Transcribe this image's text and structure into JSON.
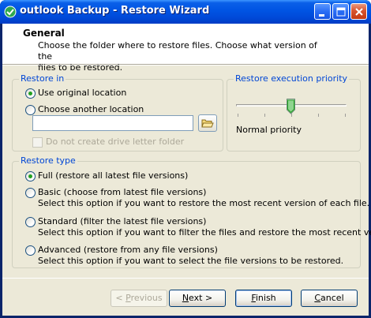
{
  "window": {
    "title": "outlook Backup - Restore Wizard",
    "title_bar_color": "#0054e3"
  },
  "header": {
    "title": "General",
    "description_line1": "Choose the folder where to restore files. Choose what version of the",
    "description_line2": "files to be restored."
  },
  "restore_in": {
    "label": "Restore in",
    "options": [
      {
        "label": "Use original location",
        "checked": true
      },
      {
        "label": "Choose another location",
        "checked": false
      }
    ],
    "location_value": "",
    "checkbox_label": "Do not create drive letter folder",
    "checkbox_checked": false
  },
  "priority": {
    "label": "Restore execution priority",
    "value_label": "Normal priority",
    "level": 0.5
  },
  "restore_type": {
    "label": "Restore type",
    "options": [
      {
        "label": "Full (restore all latest file versions)",
        "checked": true,
        "description": ""
      },
      {
        "label": "Basic (choose from latest file versions)",
        "checked": false,
        "description": "Select this option if you want to restore the most recent version of each file."
      },
      {
        "label": "Standard (filter the latest file versions)",
        "checked": false,
        "description": "Select this option if you want to filter the files and restore the most recent version."
      },
      {
        "label": "Advanced (restore from any file versions)",
        "checked": false,
        "description": "Select this option if you want to select the file versions to be restored."
      }
    ]
  },
  "buttons": {
    "previous": {
      "pre": "< ",
      "key": "P",
      "post": "revious"
    },
    "next": {
      "key": "N",
      "post": "ext >"
    },
    "finish": {
      "key": "F",
      "post": "inish"
    },
    "cancel": {
      "key": "C",
      "post": "ancel"
    }
  }
}
